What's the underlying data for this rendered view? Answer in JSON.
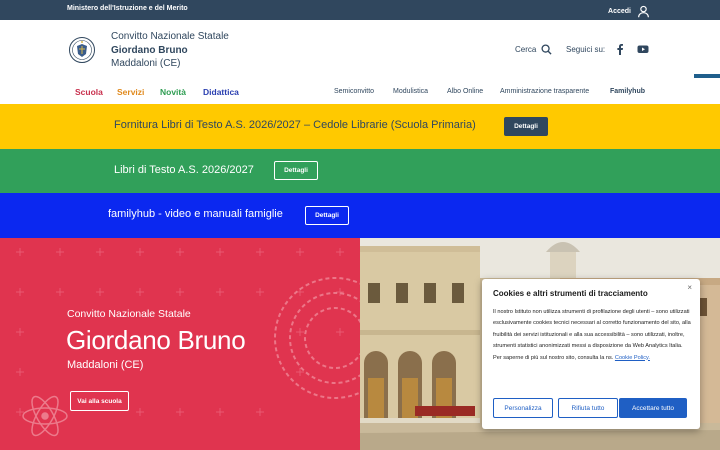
{
  "topbar": {
    "ministry": "Ministero dell'Istruzione e del Merito",
    "login": "Accedi"
  },
  "header": {
    "line1": "Convitto Nazionale Statale",
    "line2": "Giordano Bruno",
    "line3": "Maddaloni (CE)",
    "search": "Cerca",
    "follow": "Seguici su:"
  },
  "nav": {
    "main": [
      "Scuola",
      "Servizi",
      "Novità",
      "Didattica"
    ],
    "secondary": [
      "Semiconvitto",
      "Modulistica",
      "Albo Online",
      "Amministrazione trasparente",
      "Familyhub"
    ]
  },
  "banners": [
    {
      "text": "Fornitura Libri di Testo A.S. 2026/2027 – Cedole Librarie (Scuola Primaria)",
      "button": "Dettagli",
      "bg": "#ffc900"
    },
    {
      "text": "Libri di Testo A.S. 2026/2027",
      "button": "Dettagli",
      "bg": "#31a05a"
    },
    {
      "text": "familyhub - video e manuali famiglie",
      "button": "Dettagli",
      "bg": "#0b28f0"
    }
  ],
  "hero": {
    "line1": "Convitto Nazionale Statale",
    "line2": "Giordano Bruno",
    "line3": "Maddaloni (CE)",
    "button": "Vai alla scuola"
  },
  "cookie": {
    "close": "×",
    "title": "Cookies e altri strumenti di tracciamento",
    "body": "Il nostro Istituto non utilizza strumenti di profilazione degli utenti – sono utilizzati esclusivamente cookies tecnici necessari al corretto funzionamento del sito, alla fruibilità dei servizi istituzionali e alla sua accessibilità – sono utilizzati, inoltre, strumenti statistici anonimizzati messi a disposizione da Web Analytics Italia.",
    "more": "Per saperne di più sul nostro sito, consulta la ns.",
    "link": "Cookie Policy.",
    "btn_custom": "Personalizza",
    "btn_reject": "Rifiuta tutto",
    "btn_accept": "Accettare tutto"
  },
  "colors": {
    "primary": "#30475e",
    "hero": "#e0344f",
    "accept": "#1f5fc4",
    "nav_scuola": "#c8304d",
    "nav_servizi": "#e08a1e",
    "nav_novita": "#2e9d52",
    "nav_didattica": "#2a3fb0"
  }
}
